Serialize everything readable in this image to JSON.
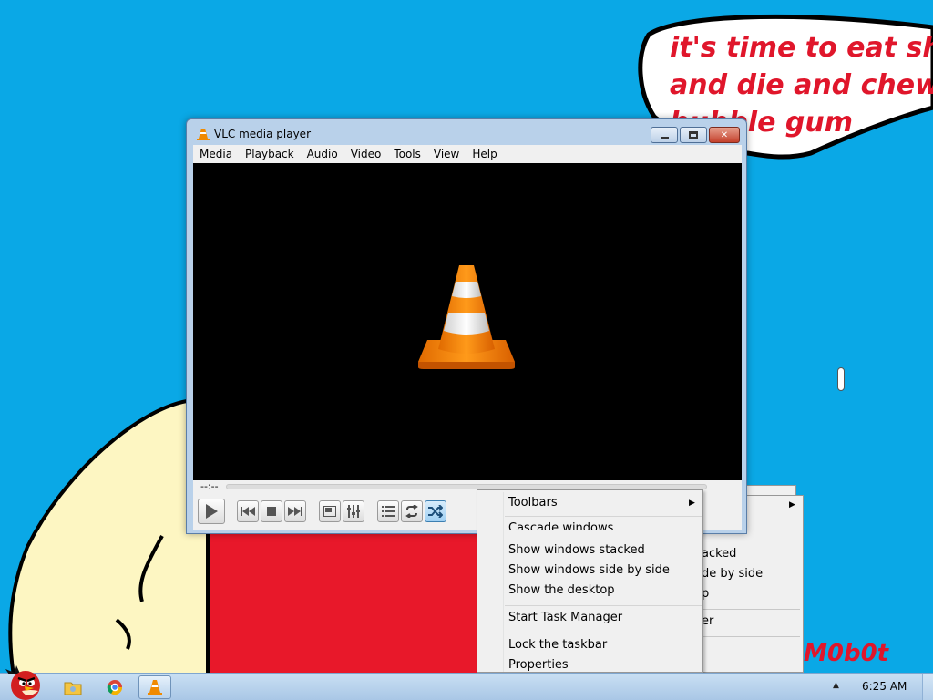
{
  "wallpaper": {
    "bubble_lines": [
      "it's time to eat shit",
      "and die and chew",
      "bubble gum"
    ],
    "signature": "M0b0t",
    "colors": {
      "background": "#0aa8e6",
      "text": "#e0162b",
      "figure": "#fdf6c2",
      "shirt": "#e8182a"
    }
  },
  "vlc": {
    "title": "VLC media player",
    "title_icon": "vlc-cone-icon",
    "window_buttons": [
      "minimize",
      "maximize",
      "close"
    ],
    "menu": [
      "Media",
      "Playback",
      "Audio",
      "Video",
      "Tools",
      "View",
      "Help"
    ],
    "time_elapsed": "--:--",
    "controls": {
      "play": "play-icon",
      "previous": "previous-icon",
      "stop": "stop-icon",
      "next": "next-icon",
      "fullscreen": "fullscreen-icon",
      "extended_settings": "equalizer-icon",
      "playlist": "playlist-icon",
      "loop": "loop-icon",
      "shuffle": "shuffle-icon"
    }
  },
  "context_menu": {
    "items": [
      {
        "label": "Toolbars",
        "submenu": true
      },
      {
        "label": "Cascade windows"
      },
      {
        "label": "Show windows stacked"
      },
      {
        "label": "Show windows side by side"
      },
      {
        "label": "Show the desktop"
      },
      {
        "label": "Start Task Manager"
      },
      {
        "label": "Lock the taskbar"
      },
      {
        "label": "Properties"
      }
    ]
  },
  "background_menu": {
    "fragments": [
      "acked",
      "de by side",
      "p",
      "er"
    ]
  },
  "taskbar": {
    "start": "start-orb-angry-bird",
    "pinned": [
      "explorer-icon",
      "chrome-icon",
      "vlc-icon"
    ],
    "active": "vlc-icon",
    "clock": "6:25 AM"
  }
}
